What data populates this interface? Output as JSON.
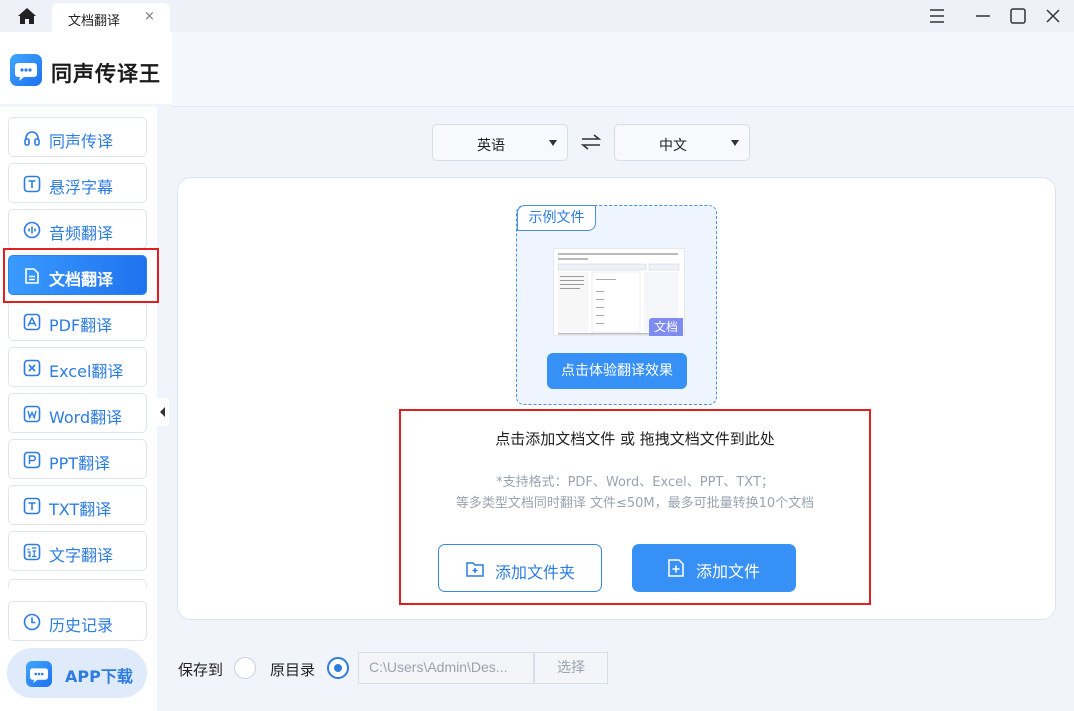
{
  "titlebar": {
    "tab_label": "文档翻译",
    "tab_close": "×",
    "icons": [
      "home-icon",
      "menu-icon",
      "minimize-icon",
      "maximize-icon",
      "close-icon"
    ]
  },
  "app": {
    "name": "同声传译王"
  },
  "sidebar": {
    "items": [
      {
        "label": "同声传译",
        "icon": "headphones-icon"
      },
      {
        "label": "悬浮字幕",
        "icon": "text-t-icon"
      },
      {
        "label": "音频翻译",
        "icon": "audio-icon"
      },
      {
        "label": "文档翻译",
        "icon": "document-icon",
        "active": true
      },
      {
        "label": "PDF翻译",
        "icon": "pdf-icon"
      },
      {
        "label": "Excel翻译",
        "icon": "excel-icon"
      },
      {
        "label": "Word翻译",
        "icon": "word-icon"
      },
      {
        "label": "PPT翻译",
        "icon": "ppt-icon"
      },
      {
        "label": "TXT翻译",
        "icon": "txt-icon"
      },
      {
        "label": "文字翻译",
        "icon": "translate-text-icon"
      }
    ],
    "history": "历史记录",
    "app_download": "APP下载"
  },
  "lang": {
    "source": "英语",
    "target": "中文"
  },
  "sample": {
    "tag": "示例文件",
    "badge": "文档",
    "button": "点击体验翻译效果"
  },
  "drop": {
    "title": "点击添加文档文件 或 拖拽文档文件到此处",
    "note1": "*支持格式：PDF、Word、Excel、PPT、TXT；",
    "note2": "等多类型文档同时翻译 文件≤50M，最多可批量转换10个文档",
    "add_folder": "添加文件夹",
    "add_file": "添加文件"
  },
  "save": {
    "label": "保存到",
    "original_dir": "原目录",
    "selected": "original_dir",
    "path": "C:\\Users\\Admin\\Des...",
    "choose": "选择"
  },
  "colors": {
    "accent": "#3690f5",
    "highlight": "#e02020"
  }
}
